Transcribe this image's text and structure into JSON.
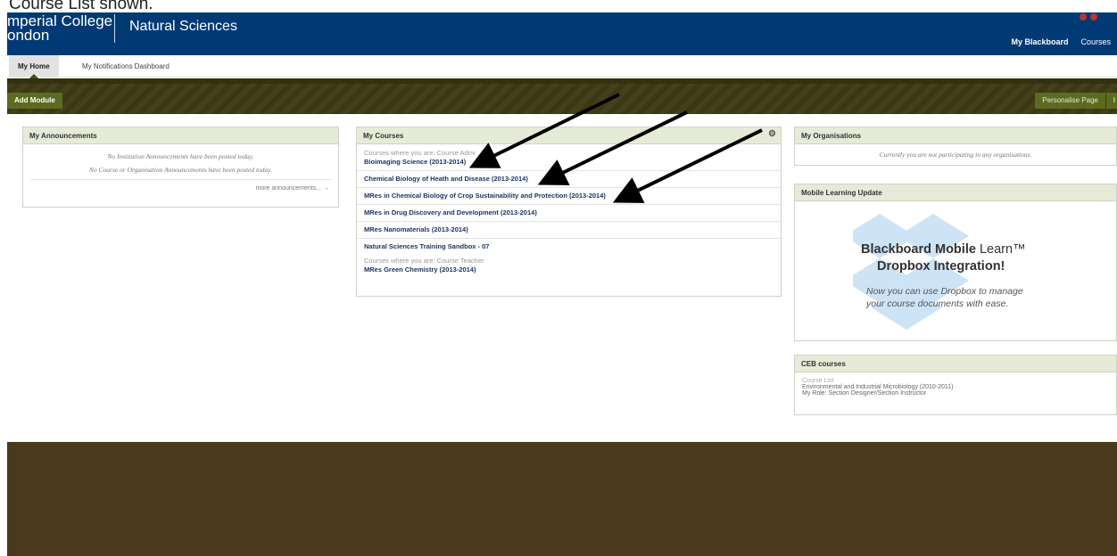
{
  "caption": "Course List shown.",
  "banner": {
    "logo_line1": "mperial College",
    "logo_line2": "ondon",
    "site_name": "Natural Sciences",
    "nav": [
      "My Blackboard",
      "Courses"
    ],
    "colors": {
      "banner": "#003a75"
    }
  },
  "tabs": {
    "my_home": "My Home",
    "notifications": "My Notifications Dashboard"
  },
  "toolbar": {
    "add_module": "Add Module",
    "personalise": "Personalise Page",
    "extra": "I"
  },
  "announcements": {
    "title": "My Announcements",
    "line1": "No Institution Announcements have been posted today.",
    "line2": "No Course or Organisation Announcements have been posted today.",
    "more": "more announcements... →"
  },
  "courses": {
    "title": "My Courses",
    "role_admin": "Courses where you are: Course Admi",
    "admin_list": [
      "Bioimaging Science (2013-2014)",
      "Chemical Biology of Heath and Disease (2013-2014)",
      "MRes in Chemical Biology of Crop Sustainability and Protection (2013-2014)",
      "MRes in Drug Discovery and Development (2013-2014)",
      "MRes Nanomaterials (2013-2014)",
      "Natural Sciences Training Sandbox - 07"
    ],
    "role_teacher": "Courses where you are: Course Teacher",
    "teacher_list": [
      "MRes Green Chemistry (2013-2014)"
    ]
  },
  "organisations": {
    "title": "My Organisations",
    "empty": "Currently you are not participating in any organisations."
  },
  "mobile": {
    "title": "Mobile Learning Update",
    "promo_bold": "Blackboard Mobile",
    "promo_thin": " Learn™",
    "promo_sub": "Dropbox Integration!",
    "desc1": "Now you can use Dropbox to manage",
    "desc2": "your course documents with ease."
  },
  "ceb": {
    "title": "CEB courses",
    "line1": "Course List",
    "line2": "Environmental and Industrial Microbiology (2010-2011)",
    "line3": "My Role: Section Designer/Section Instructor"
  }
}
